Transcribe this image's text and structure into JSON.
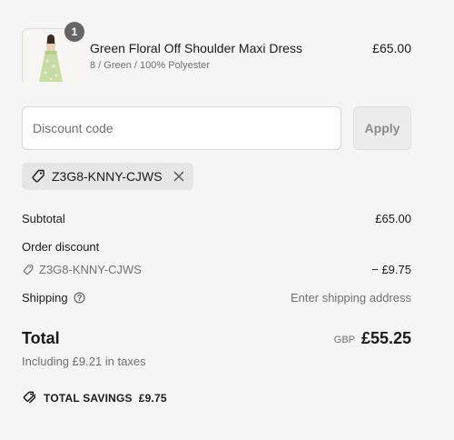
{
  "cart": {
    "item": {
      "quantity": "1",
      "name": "Green Floral Off Shoulder Maxi Dress",
      "variant": "8 / Green / 100% Polyester",
      "price": "£65.00",
      "image_icon": "dress-thumbnail"
    }
  },
  "discount": {
    "placeholder": "Discount code",
    "apply_label": "Apply",
    "applied_code": "Z3G8-KNNY-CJWS"
  },
  "summary": {
    "subtotal_label": "Subtotal",
    "subtotal_value": "£65.00",
    "order_discount_label": "Order discount",
    "discount_code": "Z3G8-KNNY-CJWS",
    "discount_value": "− £9.75",
    "shipping_label": "Shipping",
    "shipping_value": "Enter shipping address",
    "total_label": "Total",
    "currency": "GBP",
    "total_value": "£55.25",
    "tax_note": "Including £9.21 in taxes",
    "savings_label": "TOTAL SAVINGS",
    "savings_value": "£9.75"
  },
  "colors": {
    "background": "#f5f5f5",
    "text": "#1a1a1a",
    "muted": "#707070",
    "badge": "#666666"
  }
}
